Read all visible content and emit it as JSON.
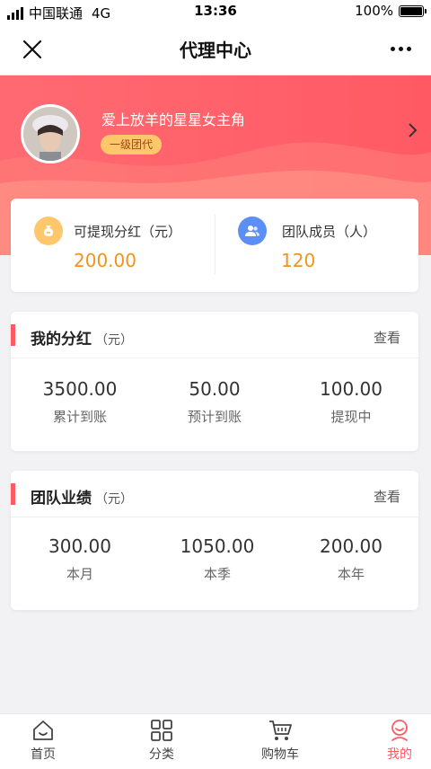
{
  "status_bar": {
    "carrier": "中国联通",
    "network": "4G",
    "time": "13:36",
    "battery": "100%"
  },
  "nav": {
    "title": "代理中心"
  },
  "profile": {
    "username": "爱上放羊的星星女主角",
    "level": "一级团代"
  },
  "summary": {
    "dividend_label": "可提现分红（元）",
    "dividend_value": "200.00",
    "team_label": "团队成员（人）",
    "team_value": "120"
  },
  "my_dividend": {
    "title": "我的分红",
    "unit": "（元）",
    "view_label": "查看",
    "stats": [
      {
        "value": "3500.00",
        "label": "累计到账"
      },
      {
        "value": "50.00",
        "label": "预计到账"
      },
      {
        "value": "100.00",
        "label": "提现中"
      }
    ]
  },
  "team_performance": {
    "title": "团队业绩",
    "unit": "（元）",
    "view_label": "查看",
    "stats": [
      {
        "value": "300.00",
        "label": "本月"
      },
      {
        "value": "1050.00",
        "label": "本季"
      },
      {
        "value": "200.00",
        "label": "本年"
      }
    ]
  },
  "tabbar": {
    "items": [
      {
        "label": "首页",
        "icon": "home-icon"
      },
      {
        "label": "分类",
        "icon": "category-icon"
      },
      {
        "label": "购物车",
        "icon": "cart-icon"
      },
      {
        "label": "我的",
        "icon": "profile-icon"
      }
    ],
    "active_index": 3
  },
  "colors": {
    "accent": "#ff5a64",
    "amount": "#f2931e",
    "badge": "#ffc76b"
  }
}
